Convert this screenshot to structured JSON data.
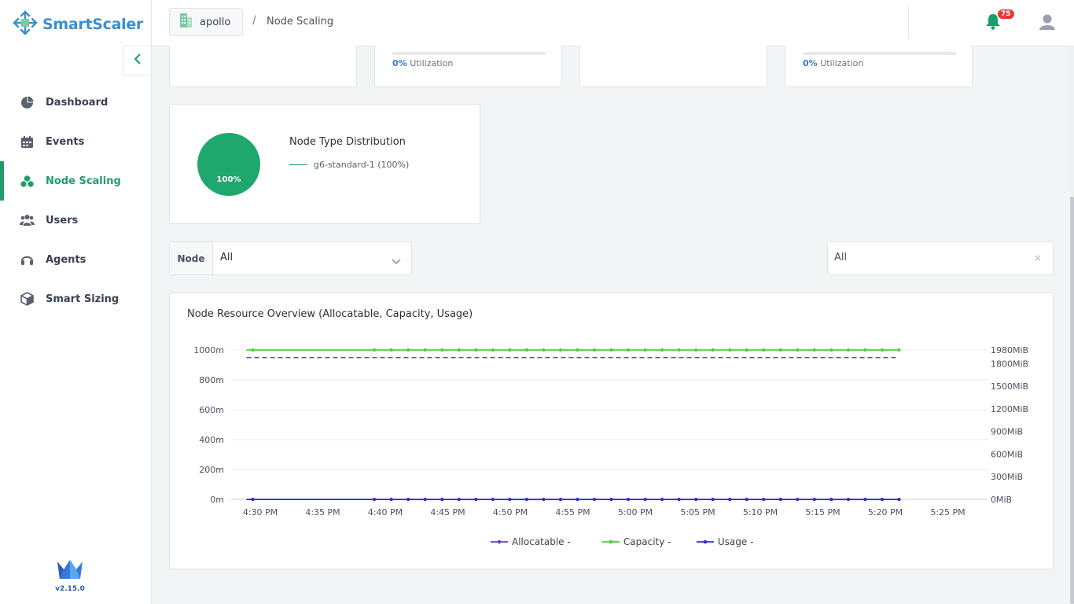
{
  "app": {
    "name": "SmartScaler",
    "version": "v2.15.0",
    "accent": "#1f9d69",
    "brand": "#3a8fd0"
  },
  "sidebar": {
    "items": [
      {
        "label": "Dashboard",
        "icon": "pie-chart-icon",
        "active": false
      },
      {
        "label": "Events",
        "icon": "calendar-icon",
        "active": false
      },
      {
        "label": "Node Scaling",
        "icon": "cubes-icon",
        "active": true
      },
      {
        "label": "Users",
        "icon": "users-icon",
        "active": false
      },
      {
        "label": "Agents",
        "icon": "headset-icon",
        "active": false
      },
      {
        "label": "Smart Sizing",
        "icon": "box-icon",
        "active": false
      }
    ]
  },
  "header": {
    "cluster": "apollo",
    "breadcrumb_sep": "/",
    "breadcrumb": "Node Scaling",
    "notifications": "75"
  },
  "summary_cards": {
    "card2": {
      "utilization_pct": "0%",
      "utilization_label": "Utilization",
      "fill": 0
    },
    "card4": {
      "utilization_pct": "0%",
      "utilization_label": "Utilization",
      "fill": 0
    }
  },
  "distribution": {
    "title": "Node Type Distribution",
    "legend": "g6-standard-1 (100%)",
    "pie_label": "100%",
    "slices": [
      {
        "name": "g6-standard-1",
        "value": 100
      }
    ]
  },
  "filters": {
    "node_label": "Node",
    "node_value": "All",
    "right_value": "All",
    "clear": "×"
  },
  "chart_data": {
    "type": "line",
    "title": "Node Resource Overview (Allocatable, Capacity, Usage)",
    "x_ticks": [
      "4:30 PM",
      "4:35 PM",
      "4:40 PM",
      "4:45 PM",
      "4:50 PM",
      "4:55 PM",
      "5:00 PM",
      "5:05 PM",
      "5:10 PM",
      "5:15 PM",
      "5:20 PM",
      "5:25 PM"
    ],
    "y_left_ticks": [
      "0m",
      "200m",
      "400m",
      "600m",
      "800m",
      "1000m"
    ],
    "y_left_range": [
      0,
      1000
    ],
    "y_right_ticks": [
      {
        "label": "0MiB",
        "value": 0
      },
      {
        "label": "300MiB",
        "value": 300
      },
      {
        "label": "600MiB",
        "value": 600
      },
      {
        "label": "900MiB",
        "value": 900
      },
      {
        "label": "1200MiB",
        "value": 1200
      },
      {
        "label": "1500MiB",
        "value": 1500
      },
      {
        "label": "1800MiB",
        "value": 1800
      },
      {
        "label": "1980MiB",
        "value": 1980
      }
    ],
    "y_right_range": [
      0,
      1980
    ],
    "x_range_minutes": [
      0,
      60
    ],
    "series": [
      {
        "name": "Allocatable -",
        "color": "#6a3fc0",
        "axis": "left",
        "value": 0,
        "style": "solid",
        "x_start": 0,
        "x_end": 50
      },
      {
        "name": "Capacity -",
        "color": "#4cd137",
        "axis": "left",
        "value": 1000,
        "style": "solid",
        "x_start": 0,
        "x_end": 50
      },
      {
        "name": "Usage -",
        "color": "#3030d0",
        "axis": "left",
        "value": 0,
        "style": "solid",
        "x_start": 0,
        "x_end": 50
      },
      {
        "name": "",
        "color": "#6a3fc0",
        "axis": "right",
        "value": 1880,
        "style": "dashed",
        "x_start": 0,
        "x_end": 50
      }
    ],
    "grid": true,
    "legend_position": "bottom"
  }
}
